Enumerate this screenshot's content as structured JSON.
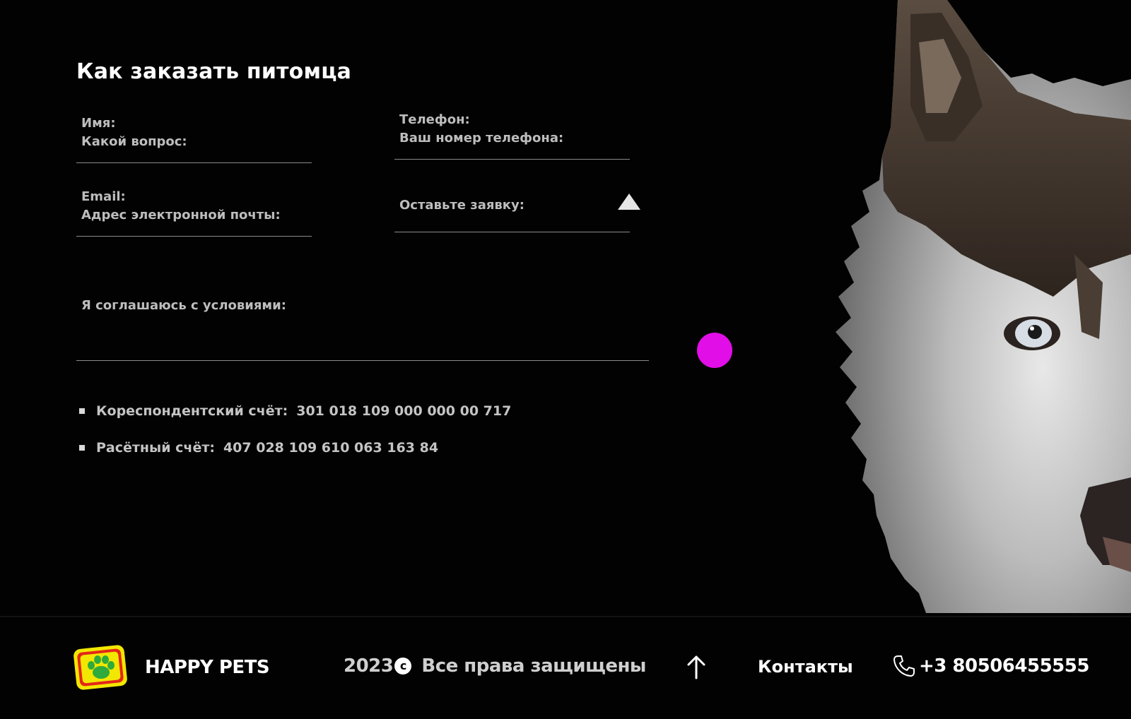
{
  "form": {
    "title": "Как заказать питомца",
    "name": {
      "label": "Имя:",
      "placeholder": "Какой вопрос:"
    },
    "phone": {
      "label": "Телефон:",
      "placeholder": "Ваш номер телефона:"
    },
    "email": {
      "label": "Email:",
      "placeholder": "Адрес электронной почты:"
    },
    "order": {
      "placeholder": "Оставьте заявку:"
    },
    "agree": {
      "label": "Я соглашаюсь с условиями:"
    },
    "submit_color": "#e10ee8"
  },
  "accounts": [
    {
      "label": "Кореспондентский счёт:",
      "value": "301 018 109 000 000 00 717"
    },
    {
      "label": "Расётный счёт:",
      "value": "407 028 109 610 063 163 84"
    }
  ],
  "footer": {
    "brand": "HAPPY PETS",
    "year": "2023",
    "copyright_symbol": "c",
    "rights": "Все права защищены",
    "contacts_label": "Контакты",
    "phone": "+3 80506455555",
    "icons": [
      "paw-logo-icon",
      "arrow-up-icon",
      "phone-icon"
    ]
  },
  "colors": {
    "background": "#020202",
    "accent": "#e10ee8",
    "muted_text": "#bdbdbd",
    "logo_red": "#e32619",
    "logo_yellow": "#f2e700",
    "logo_green": "#2faa3c"
  }
}
